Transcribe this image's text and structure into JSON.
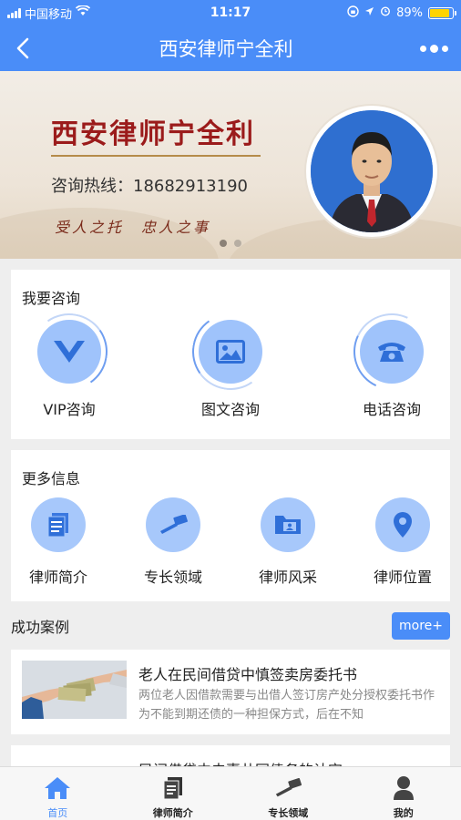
{
  "status_bar": {
    "carrier": "中国移动",
    "time": "11:17",
    "battery": "89%",
    "battery_level": 0.89
  },
  "nav": {
    "title": "西安律师宁全利"
  },
  "banner": {
    "title": "西安律师宁全利",
    "hotline": "咨询热线：18682913190",
    "slogan": "受人之托　忠人之事",
    "slides": 2,
    "active_slide": 1
  },
  "consult": {
    "heading": "我要咨询",
    "items": [
      {
        "label": "VIP咨询",
        "icon": "vip-icon"
      },
      {
        "label": "图文咨询",
        "icon": "image-icon"
      },
      {
        "label": "电话咨询",
        "icon": "phone-icon"
      }
    ]
  },
  "info": {
    "heading": "更多信息",
    "items": [
      {
        "label": "律师简介",
        "icon": "document-icon"
      },
      {
        "label": "专长领域",
        "icon": "gavel-icon"
      },
      {
        "label": "律师风采",
        "icon": "folder-profile-icon"
      },
      {
        "label": "律师位置",
        "icon": "location-pin-icon"
      }
    ]
  },
  "cases": {
    "heading": "成功案例",
    "more_label": "more+",
    "items": [
      {
        "title": "老人在民间借贷中慎签卖房委托书",
        "desc": "两位老人因借款需要与出借人签订房产处分授权委托书作为不能到期还债的一种担保方式，后在不知"
      },
      {
        "title": "民间借贷中夫妻共同债务的认定",
        "desc": ""
      }
    ]
  },
  "tabbar": {
    "tabs": [
      {
        "label": "首页",
        "icon": "home-icon",
        "active": true
      },
      {
        "label": "律师简介",
        "icon": "document-icon",
        "active": false
      },
      {
        "label": "专长领域",
        "icon": "gavel-icon",
        "active": false
      },
      {
        "label": "我的",
        "icon": "user-icon",
        "active": false
      }
    ]
  },
  "colors": {
    "primary": "#4a8df8",
    "icon_bg": "#9fc3fb",
    "banner_title": "#9b1b1b"
  }
}
